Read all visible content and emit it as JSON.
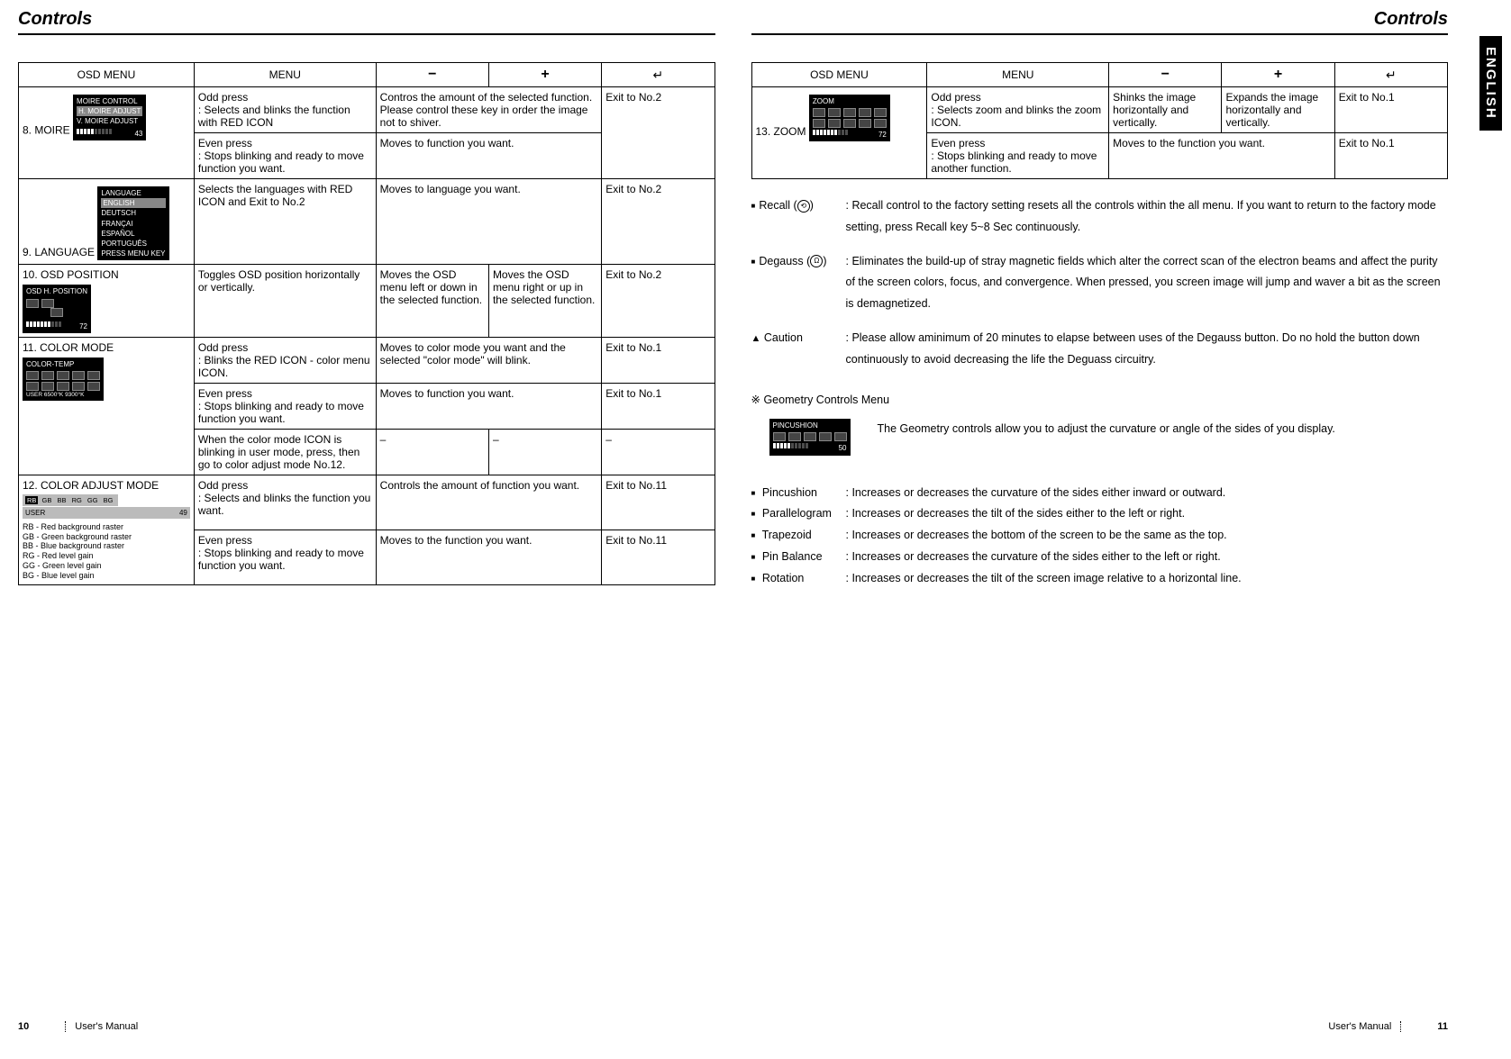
{
  "lang_tab": "ENGLISH",
  "left": {
    "title": "Controls",
    "headers": {
      "osd": "OSD MENU",
      "menu": "MENU",
      "minus": "−",
      "plus": "+",
      "enter": "↵"
    },
    "rows": {
      "moire": {
        "name": "8. MOIRE",
        "img_title": "MOIRE CONTROL",
        "img_l1": "H. MOIRE ADJUST",
        "img_l2": "V. MOIRE ADJUST",
        "img_val": "43",
        "r1_menu": "Odd press\n: Selects and blinks the function with RED ICON",
        "r1_mp": "Contros the amount of the selected function. Please control these key in order the image not to shiver.",
        "r1_enter": "Exit to No.2",
        "r2_menu": "Even press\n: Stops blinking and ready to move function you want.",
        "r2_mp": "Moves to function you want."
      },
      "lang": {
        "name": "9. LANGUAGE",
        "img_title": "LANGUAGE",
        "img_langs": [
          "ENGLISH",
          "DEUTSCH",
          "FRANÇAI",
          "ESPAÑOL",
          "PORTUGUÊS"
        ],
        "img_foot": "PRESS MENU KEY",
        "menu": "Selects the languages with RED ICON and Exit to No.2",
        "mp": "Moves to language you want.",
        "enter": "Exit to No.2"
      },
      "osdpos": {
        "name": "10. OSD POSITION",
        "img_title": "OSD H. POSITION",
        "img_val": "72",
        "menu": "Toggles OSD position horizontally or vertically.",
        "minus": "Moves the OSD menu left or down in the selected function.",
        "plus": "Moves the OSD menu right or up in the selected function.",
        "enter": "Exit to No.2"
      },
      "color": {
        "name": "11. COLOR MODE",
        "img_title": "COLOR-TEMP",
        "img_foot": "USER    6500°K    9300°K",
        "r1_menu": "Odd press\n: Blinks the RED ICON - color menu ICON.",
        "r1_mp": "Moves to color mode you want and the selected \"color mode\" will blink.",
        "r1_enter": "Exit to No.1",
        "r2_menu": "Even press\n: Stops blinking and ready to move function you want.",
        "r2_mp": "Moves to function you want.",
        "r2_enter": "Exit to No.1",
        "r3_menu": "When the color mode ICON is blinking in user mode, press, then go to color adjust mode No.12.",
        "r3_minus": "–",
        "r3_plus": "–",
        "r3_enter": "–"
      },
      "coloradj": {
        "name": "12. COLOR ADJUST MODE",
        "bar_items": [
          "RB",
          "GB",
          "BB",
          "RG",
          "GG",
          "BG"
        ],
        "bar_l": "USER",
        "bar_r": "49",
        "note": "RB - Red background raster\nGB - Green background raster\nBB - Blue background raster\nRG - Red level gain\nGG - Green level gain\nBG - Blue level gain",
        "r1_menu": "Odd press\n: Selects and blinks the function you want.",
        "r1_mp": "Controls the amount of function you want.",
        "r1_enter": "Exit to No.11",
        "r2_menu": "Even press\n: Stops blinking and ready to move function you want.",
        "r2_mp": "Moves to the function you want.",
        "r2_enter": "Exit to No.11"
      }
    },
    "footer_page": "10",
    "footer_text": "User's Manual"
  },
  "right": {
    "title": "Controls",
    "headers": {
      "osd": "OSD MENU",
      "menu": "MENU",
      "minus": "−",
      "plus": "+",
      "enter": "↵"
    },
    "rows": {
      "zoom": {
        "name": "13. ZOOM",
        "img_title": "ZOOM",
        "img_val": "72",
        "r1_menu": "Odd press\n: Selects zoom and blinks the zoom ICON.",
        "r1_minus": "Shinks the image horizontally and vertically.",
        "r1_plus": "Expands the image horizontally and vertically.",
        "r1_enter": "Exit to No.1",
        "r2_menu": "Even press\n: Stops blinking and ready to move another function.",
        "r2_mp": "Moves to the function you want.",
        "r2_enter": "Exit to No.1"
      }
    },
    "recall": {
      "label": "Recall (",
      "icon": "⟲",
      "label2": ")",
      "text": ": Recall control to the factory setting resets all the controls within the all menu. If you want to return to the factory mode setting, press Recall key 5~8 Sec continuously."
    },
    "degauss": {
      "label": "Degauss (",
      "icon": "Ω",
      "label2": ")",
      "text": ": Eliminates the build-up of stray magnetic fields which alter the correct scan of the electron beams and affect the purity of the screen colors, focus, and convergence. When pressed, you screen image will jump and waver a bit as the screen is demagnetized."
    },
    "caution": {
      "label": "Caution",
      "text": ": Please allow aminimum of 20 minutes to elapse between uses of the Degauss button. Do no hold the button down continuously to avoid decreasing the life the Deguass circuitry."
    },
    "geom_title": "Geometry Controls Menu",
    "geom_img_title": "PINCUSHION",
    "geom_img_val": "50",
    "geom_text": "The Geometry controls allow you to adjust the curvature or angle of the sides of you display.",
    "geom_items": [
      {
        "l": "Pincushion",
        "d": ": Increases or decreases the curvature of the sides either inward or outward."
      },
      {
        "l": "Parallelogram",
        "d": ": Increases or decreases the tilt of the sides either to the left or right."
      },
      {
        "l": "Trapezoid",
        "d": ": Increases or decreases the bottom of the screen to be the same as the top."
      },
      {
        "l": "Pin Balance",
        "d": ": Increases or decreases the curvature of the sides either to the left or right."
      },
      {
        "l": "Rotation",
        "d": ": Increases or decreases the tilt of the screen image relative to a horizontal line."
      }
    ],
    "footer_text": "User's Manual",
    "footer_page": "11"
  }
}
